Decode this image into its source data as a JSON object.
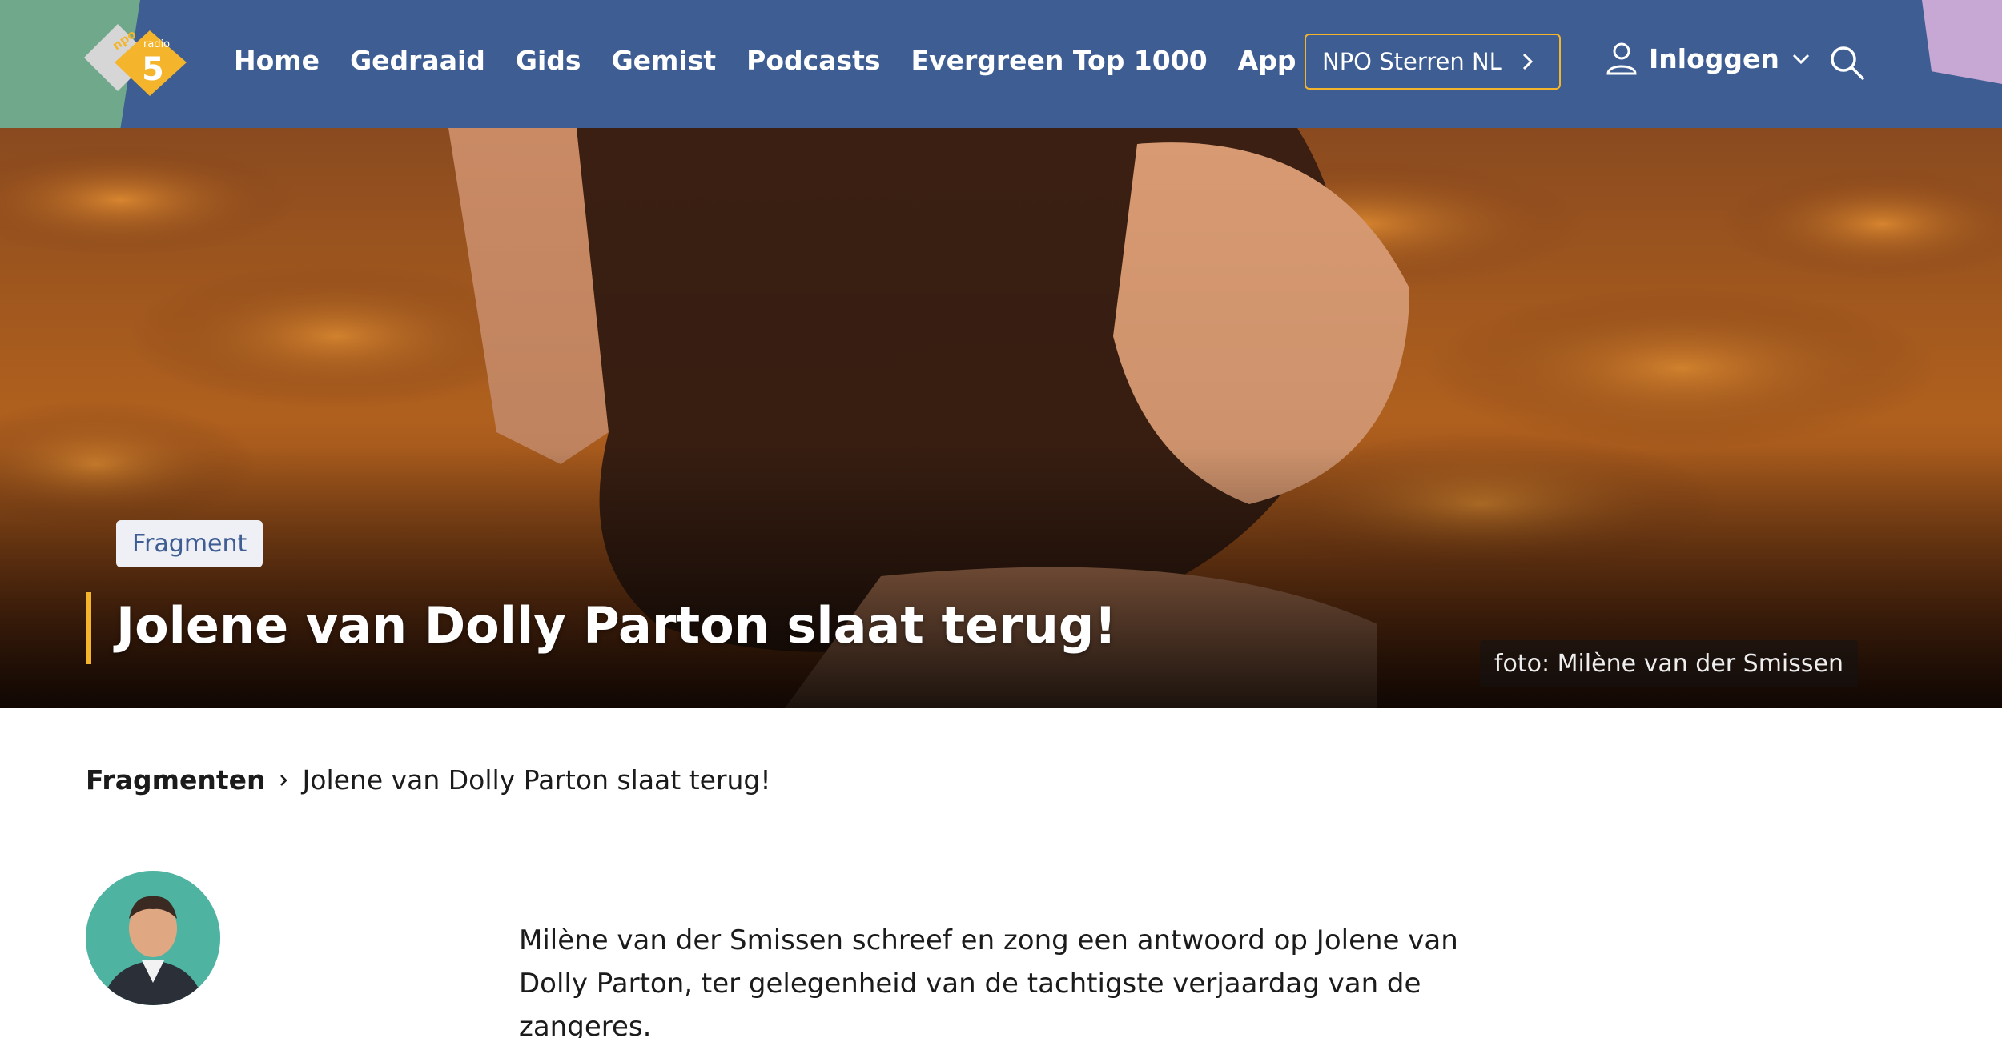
{
  "header": {
    "logo_top": "npo",
    "logo_middle": "radio",
    "logo_number": "5",
    "nav": [
      "Home",
      "Gedraaid",
      "Gids",
      "Gemist",
      "Podcasts",
      "Evergreen Top 1000",
      "App"
    ],
    "sterren_label": "NPO Sterren NL",
    "login_label": "Inloggen"
  },
  "hero": {
    "badge": "Fragment",
    "title": "Jolene van Dolly Parton slaat terug!",
    "credit": "foto: Milène van der Smissen"
  },
  "breadcrumb": {
    "root": "Fragmenten",
    "current": "Jolene van Dolly Parton slaat terug!"
  },
  "article": {
    "intro": "Milène van der Smissen schreef en zong een antwoord op Jolene van Dolly Parton, ter gelegenheid van de tachtigste verjaardag van de zangeres."
  },
  "colors": {
    "header_bg": "#3d5d93",
    "accent_yellow": "#f4b52d",
    "corner_green": "#6fa88a",
    "corner_lilac": "#c7a7d3",
    "avatar_bg": "#4fb3a2"
  },
  "icons": {
    "sterren": "chevron-right-icon",
    "login": "user-icon",
    "login_menu": "chevron-down-icon",
    "search": "search-icon",
    "breadcrumb_separator": "chevron-right-icon"
  }
}
